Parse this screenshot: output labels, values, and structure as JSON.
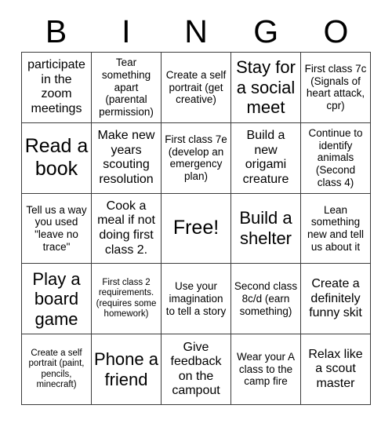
{
  "card": {
    "header_letters": [
      "B",
      "I",
      "N",
      "G",
      "O"
    ],
    "columns": 5,
    "rows": 5,
    "border_color": "#3b3b3b",
    "background_color": "#ffffff",
    "text_color": "#000000",
    "free_space_index": 12,
    "cells": [
      {
        "text": "participate in the zoom meetings",
        "size": "md"
      },
      {
        "text": "Tear something apart (parental permission)",
        "size": "sm"
      },
      {
        "text": "Create a self portrait (get creative)",
        "size": "sm"
      },
      {
        "text": "Stay for a social meet",
        "size": "lg"
      },
      {
        "text": "First class 7c (Signals of heart attack, cpr)",
        "size": "sm"
      },
      {
        "text": "Read a book",
        "size": "xl"
      },
      {
        "text": "Make new years scouting resolution",
        "size": "md"
      },
      {
        "text": "First class 7e (develop an emergency plan)",
        "size": "sm"
      },
      {
        "text": "Build a new origami creature",
        "size": "md"
      },
      {
        "text": "Continue to identify animals (Second class 4)",
        "size": "sm"
      },
      {
        "text": "Tell us a way you used \"leave no trace\"",
        "size": "sm"
      },
      {
        "text": "Cook a meal if not doing first class 2.",
        "size": "md"
      },
      {
        "text": "Free!",
        "size": "xl"
      },
      {
        "text": "Build a shelter",
        "size": "lg"
      },
      {
        "text": "Lean something new and tell us about it",
        "size": "sm"
      },
      {
        "text": "Play a board game",
        "size": "lg"
      },
      {
        "text": "First class 2 requirements. (requires some homework)",
        "size": "xs"
      },
      {
        "text": "Use your imagination to tell a story",
        "size": "sm"
      },
      {
        "text": "Second class 8c/d (earn something)",
        "size": "sm"
      },
      {
        "text": "Create a definitely funny skit",
        "size": "md"
      },
      {
        "text": "Create a self portrait (paint, pencils, minecraft)",
        "size": "xs"
      },
      {
        "text": "Phone a friend",
        "size": "lg"
      },
      {
        "text": "Give feedback on the campout",
        "size": "md"
      },
      {
        "text": "Wear your A class to the camp fire",
        "size": "sm"
      },
      {
        "text": "Relax like a scout master",
        "size": "md"
      }
    ]
  }
}
